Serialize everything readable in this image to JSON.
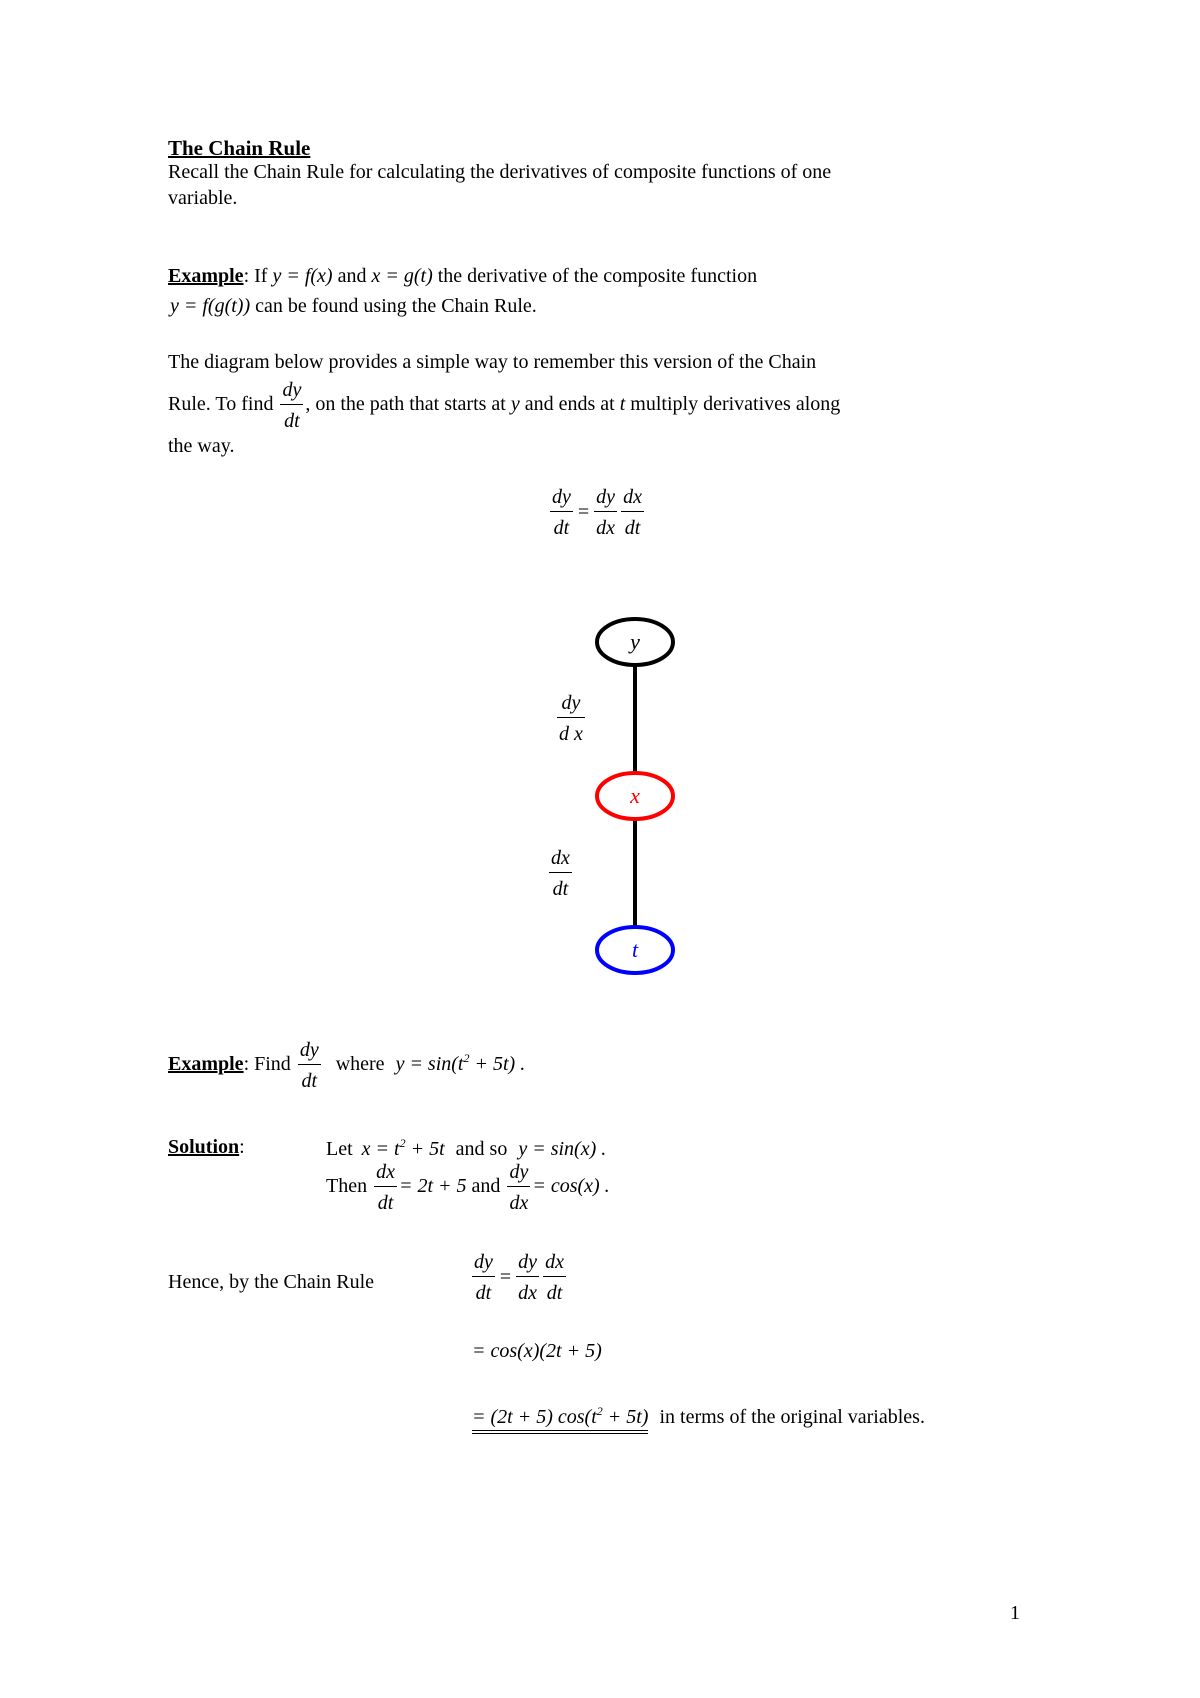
{
  "title": "The Chain Rule",
  "intro": {
    "line1": "Recall the Chain Rule for calculating the derivatives of composite functions of one",
    "line2": "variable."
  },
  "example1": {
    "label": "Example",
    "colon": ":",
    "if_text": "If",
    "eq1": "y = f(x)",
    "and_text": "and",
    "eq2": "x = g(t)",
    "rest": "the derivative of the composite function",
    "eq3": "y = f(g(t))",
    "rest2": "can be found using the Chain Rule."
  },
  "diagram_text": {
    "line1": "The diagram below provides a simple way to remember this version of the Chain",
    "line2_pre": "Rule.  To find",
    "frac_num": "dy",
    "frac_den": "dt",
    "line2_post": ", on the path that starts at",
    "var_y": "y",
    "and_ends": "and ends at",
    "var_t": "t",
    "multiply": "multiply derivatives along",
    "line3": "the way."
  },
  "chain_formula": {
    "lhs_num": "dy",
    "lhs_den": "dt",
    "eq": "=",
    "r1_num": "dy",
    "r1_den": "dx",
    "r2_num": "dx",
    "r2_den": "dt"
  },
  "tree": {
    "nodes": [
      {
        "label": "y",
        "color": "#000000"
      },
      {
        "label": "x",
        "color": "#ff0000"
      },
      {
        "label": "t",
        "color": "#0000ff"
      }
    ],
    "edges": [
      {
        "num": "dy",
        "den": "d x"
      },
      {
        "num": "dx",
        "den": "dt"
      }
    ]
  },
  "example2": {
    "label": "Example",
    "colon": ":",
    "find": "Find",
    "frac_num": "dy",
    "frac_den": "dt",
    "where": "where",
    "eq_pre": "y = sin(t",
    "sup": "2",
    "eq_post": " + 5t) ."
  },
  "solution": {
    "label": "Solution",
    "colon": ":",
    "line1_let": "Let",
    "line1_eq_pre": "x = t",
    "line1_sup": "2",
    "line1_eq_post": " + 5t",
    "line1_andso": "and so",
    "line1_eq2": "y = sin(x) .",
    "line2_then": "Then",
    "line2_f1_num": "dx",
    "line2_f1_den": "dt",
    "line2_eq1": "= 2t + 5",
    "line2_and": "and",
    "line2_f2_num": "dy",
    "line2_f2_den": "dx",
    "line2_eq2": "= cos(x) ."
  },
  "hence": {
    "text": "Hence, by the Chain Rule",
    "lhs_num": "dy",
    "lhs_den": "dt",
    "eq": "=",
    "r1_num": "dy",
    "r1_den": "dx",
    "r2_num": "dx",
    "r2_den": "dt",
    "step2": "= cos(x)(2t + 5)",
    "step3_pre": "= (2t + 5) cos(t",
    "step3_sup": "2",
    "step3_post": " + 5t)",
    "step3_tail": "in terms of the original variables."
  },
  "page_number": "1"
}
